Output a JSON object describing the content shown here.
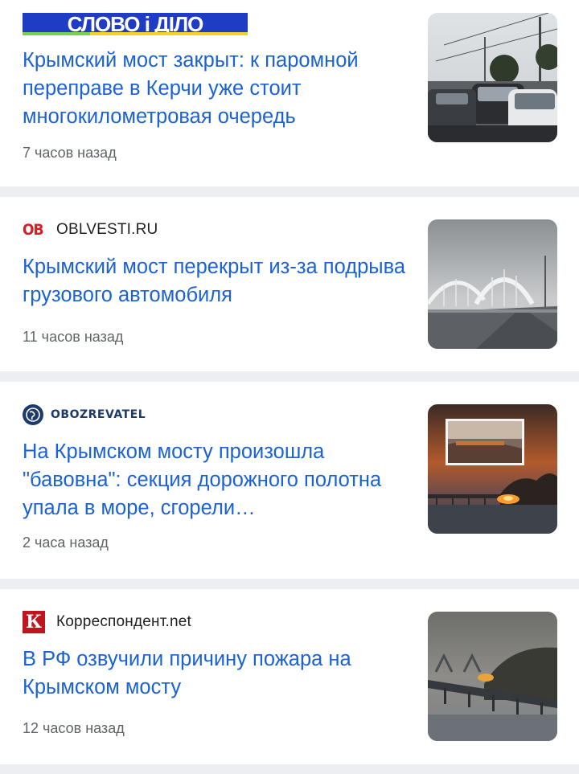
{
  "articles": [
    {
      "source": "СЛОВО і ДІЛО",
      "title": "Крымский мост закрыт: к паромной переправе в Керчи уже стоит многокилометровая очередь",
      "time": "7 часов назад",
      "thumb_icon": "traffic-queue-photo"
    },
    {
      "source": "OBLVESTI.RU",
      "logo_text": "OB",
      "title": "Крымский мост перекрыт из-за подрыва грузового автомобиля",
      "time": "11 часов назад",
      "thumb_icon": "bridge-arch-photo"
    },
    {
      "source": "OBOZREVATEL",
      "title": "На Крымском мосту произошла \"бавовна\": секция дорожного полотна упала в море, сгорели…",
      "time": "2 часа назад",
      "thumb_icon": "bridge-fire-photo"
    },
    {
      "source": "Корреспондент.net",
      "logo_text": "К",
      "title": "В РФ озвучили причину пожара на Крымском мосту",
      "time": "12 часов назад",
      "thumb_icon": "bridge-smoke-photo"
    }
  ],
  "colors": {
    "title": "#1a62d6",
    "time": "#5f6368",
    "divider": "#eceef1"
  }
}
